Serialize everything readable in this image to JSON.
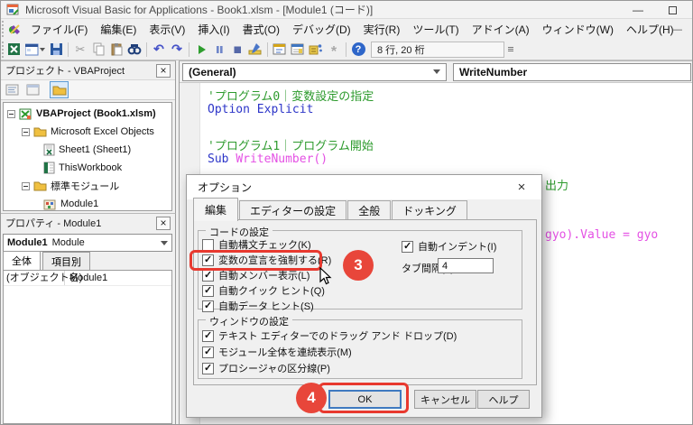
{
  "window": {
    "title": "Microsoft Visual Basic for Applications - Book1.xlsm - [Module1 (コード)]",
    "minimize_glyph": "—"
  },
  "menubar": {
    "items": [
      "ファイル(F)",
      "編集(E)",
      "表示(V)",
      "挿入(I)",
      "書式(O)",
      "デバッグ(D)",
      "実行(R)",
      "ツール(T)",
      "アドイン(A)",
      "ウィンドウ(W)",
      "ヘルプ(H)"
    ],
    "child_minimize_glyph": "—"
  },
  "toolbar": {
    "icons": [
      "view-microsoft-excel-icon",
      "insert-userform-icon",
      "save-icon",
      "cut-icon",
      "copy-icon",
      "paste-icon",
      "find-icon",
      "undo-icon",
      "redo-icon",
      "run-icon",
      "break-icon",
      "reset-icon",
      "design-mode-icon",
      "project-explorer-icon",
      "properties-window-icon",
      "object-browser-icon",
      "toolbox-icon",
      "help-icon"
    ],
    "position_indicator": "8 行, 20 桁"
  },
  "project_panel": {
    "title": "プロジェクト - VBAProject",
    "close_glyph": "×",
    "toolbar_icons": [
      "view-code-icon",
      "view-object-icon",
      "toggle-folders-icon"
    ],
    "tree": [
      {
        "label": "VBAProject (Book1.xlsm)",
        "icon": "vba-project-icon"
      },
      {
        "label": "Microsoft Excel Objects",
        "icon": "folder-icon"
      },
      {
        "label": "Sheet1 (Sheet1)",
        "icon": "worksheet-icon"
      },
      {
        "label": "ThisWorkbook",
        "icon": "workbook-icon"
      },
      {
        "label": "標準モジュール",
        "icon": "folder-icon"
      },
      {
        "label": "Module1",
        "icon": "module-icon"
      }
    ]
  },
  "properties_panel": {
    "title": "プロパティ - Module1",
    "close_glyph": "×",
    "object_name": "Module1",
    "object_type": "Module",
    "tabs": [
      "全体",
      "項目別"
    ],
    "property_name": "(オブジェクト名)",
    "property_value": "Module1"
  },
  "code_window": {
    "object_combo": "(General)",
    "procedure_combo": "WriteNumber",
    "minimize_glyph": "—",
    "lines": {
      "comment0": "'プログラム0｜変数設定の指定",
      "option_explicit": "Option Explicit",
      "comment1": "'プログラム1｜プログラム開始",
      "sub_keyword": "Sub ",
      "sub_name": "WriteNumber()"
    },
    "fragments": {
      "comment_fragment": "出力",
      "code_fragment": "gyo).Value = gyo"
    }
  },
  "options_dialog": {
    "title": "オプション",
    "close_glyph": "×",
    "tabs": [
      "編集",
      "エディターの設定",
      "全般",
      "ドッキング"
    ],
    "code_settings": {
      "legend": "コードの設定",
      "auto_syntax": {
        "label": "自動構文チェック(K)",
        "checked": false
      },
      "require_declaration": {
        "label": "変数の宣言を強制する(R)",
        "checked": true
      },
      "auto_member": {
        "label": "自動メンバー表示(L)",
        "checked": true
      },
      "auto_quick": {
        "label": "自動クイック ヒント(Q)",
        "checked": true
      },
      "auto_data": {
        "label": "自動データ ヒント(S)",
        "checked": true
      },
      "auto_indent": {
        "label": "自動インデント(I)",
        "checked": true
      },
      "tab_width_label": "タブ間隔(T):",
      "tab_width_value": "4"
    },
    "window_settings": {
      "legend": "ウィンドウの設定",
      "drag_drop": {
        "label": "テキスト エディターでのドラッグ アンド ドロップ(D)",
        "checked": true
      },
      "full_module_view": {
        "label": "モジュール全体を連続表示(M)",
        "checked": true
      },
      "procedure_separator": {
        "label": "プロシージャの区分線(P)",
        "checked": true
      }
    },
    "buttons": {
      "ok": "OK",
      "cancel": "キャンセル",
      "help": "ヘルプ"
    }
  },
  "annotations": {
    "step3_badge": "3",
    "step4_badge": "4"
  },
  "colors": {
    "comment_green": "#2e9b2e",
    "keyword_blue": "#2c35c8",
    "identifier_magenta": "#e450e4",
    "annotation_red": "#e8463a",
    "focus_blue": "#3f7ac0"
  }
}
